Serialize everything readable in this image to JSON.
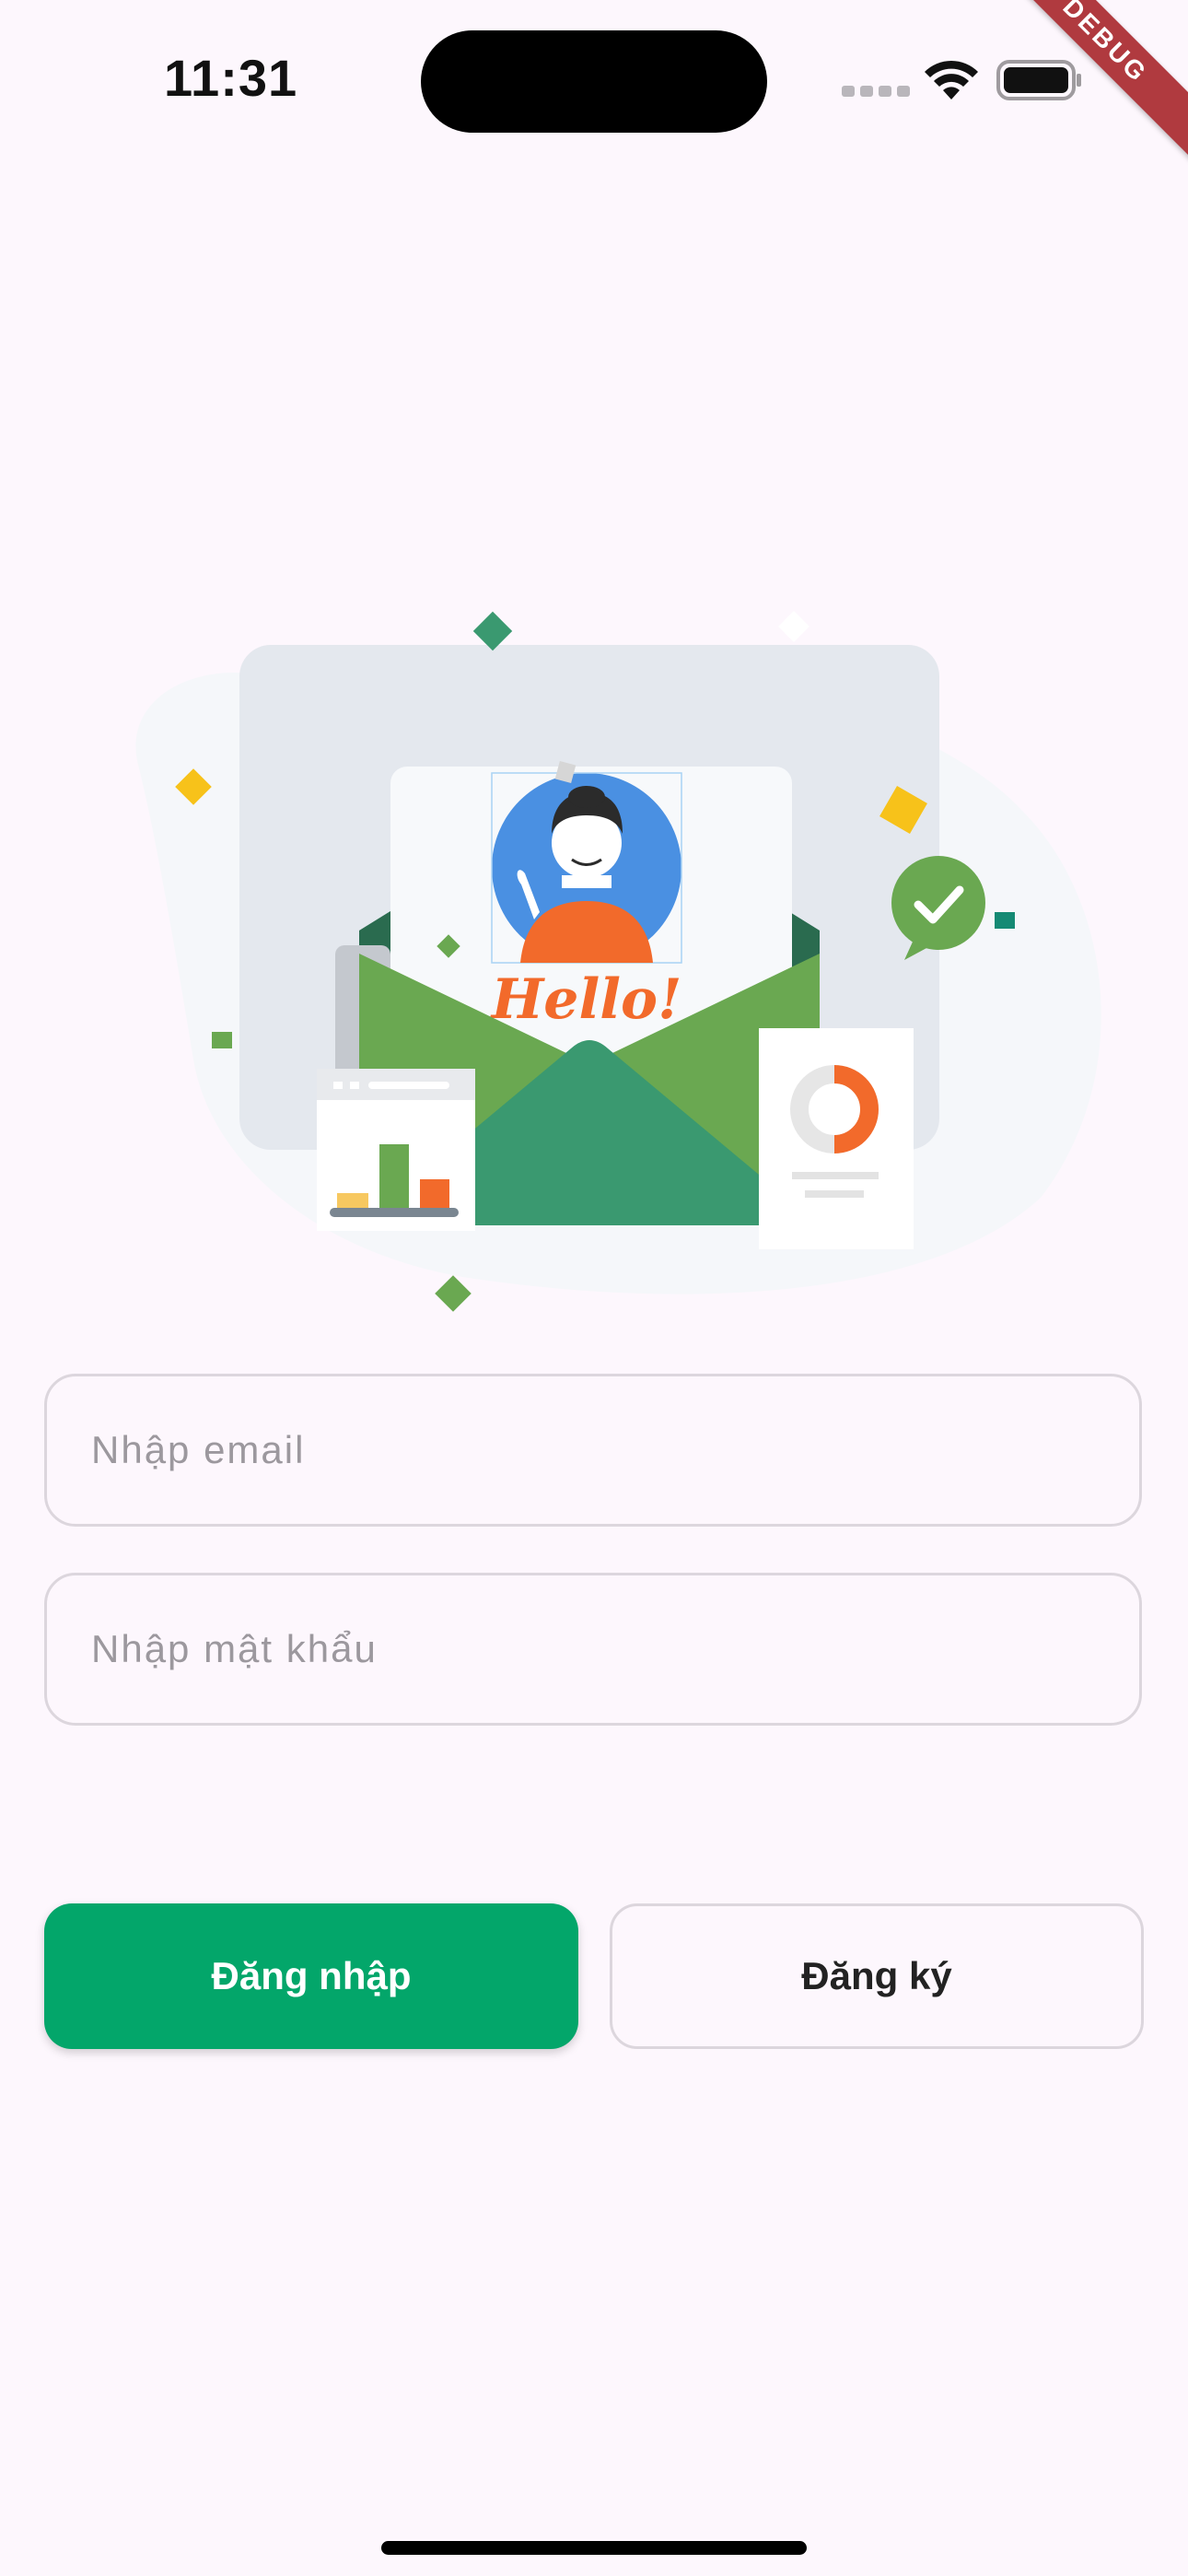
{
  "status_bar": {
    "time": "11:31",
    "debug_banner": "DEBUG"
  },
  "illustration": {
    "hello_text": "Hello!"
  },
  "form": {
    "email_placeholder": "Nhập email",
    "password_placeholder": "Nhập mật khẩu"
  },
  "buttons": {
    "login_label": "Đăng nhập",
    "register_label": "Đăng ký"
  },
  "colors": {
    "primary": "#03a66a",
    "background": "#fdf7fd",
    "accent_orange": "#f26a2b",
    "accent_blue": "#4a90e2"
  }
}
